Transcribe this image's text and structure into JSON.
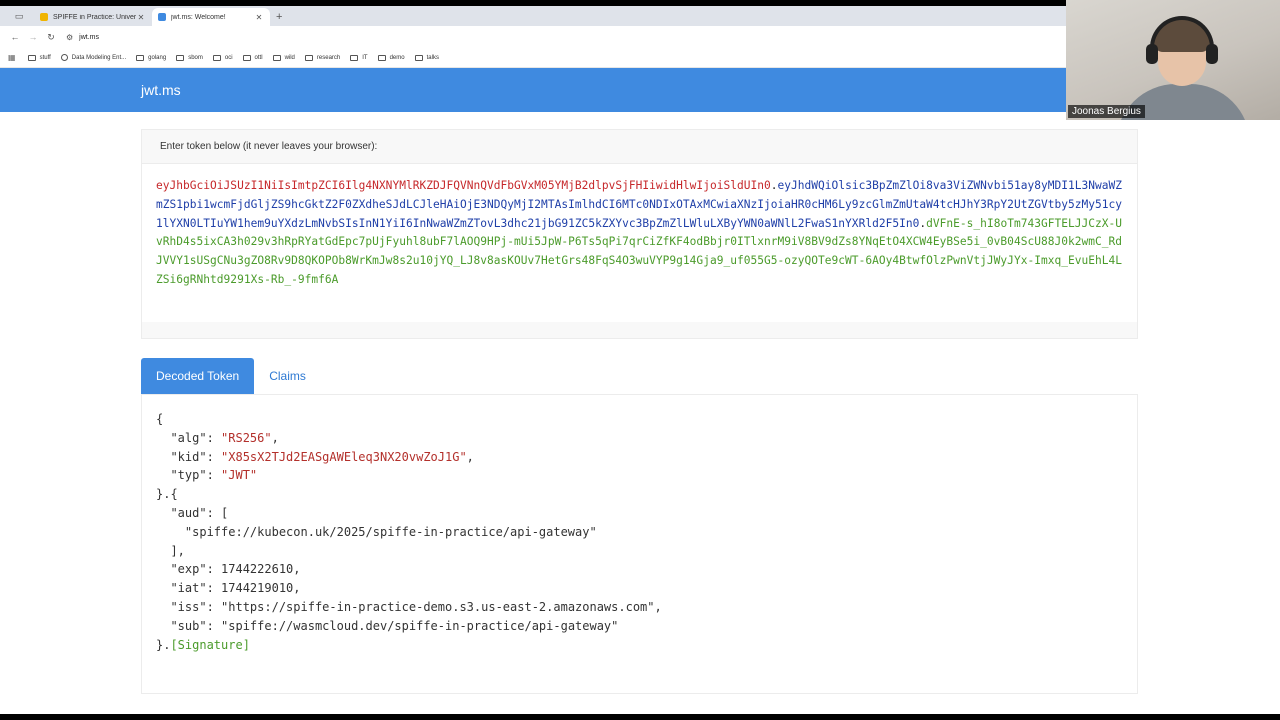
{
  "browser": {
    "tabs": [
      {
        "title": "SPIFFE in Practice: Universal",
        "active": false,
        "favicon_color": "#f0b400"
      },
      {
        "title": "jwt.ms: Welcome!",
        "active": true,
        "favicon_color": "#3f8ae0"
      }
    ],
    "url": "jwt.ms",
    "bookmarks": [
      {
        "label": "stuff",
        "type": "folder"
      },
      {
        "label": "Data Modeling Ent...",
        "type": "site"
      },
      {
        "label": "golang",
        "type": "folder"
      },
      {
        "label": "sbom",
        "type": "folder"
      },
      {
        "label": "oci",
        "type": "folder"
      },
      {
        "label": "ottl",
        "type": "folder"
      },
      {
        "label": "wild",
        "type": "folder"
      },
      {
        "label": "research",
        "type": "folder"
      },
      {
        "label": "IT",
        "type": "folder"
      },
      {
        "label": "demo",
        "type": "folder"
      },
      {
        "label": "talks",
        "type": "folder"
      }
    ]
  },
  "page": {
    "brand": "jwt.ms",
    "token_prompt": "Enter token below (it never leaves your browser):",
    "token": {
      "header": "eyJhbGciOiJSUzI1NiIsImtpZCI6Ilg4NXNYMlRKZDJFQVNnQVdFbGVxM05YMjB2dlpvSjFHIiwidHlwIjoiSldUIn0",
      "payload": "eyJhdWQiOlsic3BpZmZlOi8va3ViZWNvbi51ay8yMDI1L3NwaWZmZS1pbi1wcmFjdGljZS9hcGktZ2F0ZXdheSJdLCJleHAiOjE3NDQyMjI2MTAsImlhdCI6MTc0NDIxOTAxMCwiaXNzIjoiaHR0cHM6Ly9zcGlmZmUtaW4tcHJhY3RpY2UtZGVtby5zMy51cy1lYXN0LTIuYW1hem9uYXdzLmNvbSIsInN1YiI6InNwaWZmZTovL3dhc21jbG91ZC5kZXYvc3BpZmZlLWluLXByYWN0aWNlL2FwaS1nYXRld2F5In0",
      "signature": "dVFnE-s_hI8oTm743GFTELJJCzX-UvRhD4s5ixCA3h029v3hRpRYatGdEpc7pUjFyuhl8ubF7lAOQ9HPj-mUi5JpW-P6Ts5qPi7qrCiZfKF4odBbjr0ITlxnrM9iV8BV9dZs8YNqEtO4XCW4EyBSe5i_0vB04ScU88J0k2wmC_RdJVVY1sUSgCNu3gZO8Rv9D8QKOPOb8WrKmJw8s2u10jYQ_LJ8v8asKOUv7HetGrs48FqS4O3wuVYP9g14Gja9_uf055G5-ozyQOTe9cWT-6AOy4BtwfOlzPwnVtjJWyJYx-Imxq_EvuEhL4LZSi6gRNhtd9291Xs-Rb_-9fmf6A"
    },
    "tabs": {
      "decoded": "Decoded Token",
      "claims": "Claims"
    },
    "decoded": {
      "header": {
        "alg": "\"RS256\"",
        "kid": "\"X85sX2TJd2EASgAWEleq3NX20vwZoJ1G\"",
        "typ": "\"JWT\""
      },
      "payload": {
        "aud_item": "\"spiffe://kubecon.uk/2025/spiffe-in-practice/api-gateway\"",
        "exp": "1744222610,",
        "iat": "1744219010,",
        "iss": "\"https://spiffe-in-practice-demo.s3.us-east-2.amazonaws.com\",",
        "sub": "\"spiffe://wasmcloud.dev/spiffe-in-practice/api-gateway\""
      },
      "signature_label": "[Signature]"
    }
  },
  "webcam": {
    "name": "Joonas Bergius"
  },
  "colors": {
    "header_blue": "#3f8ae0",
    "token_header": "#c6282b",
    "token_payload": "#1f3fa8",
    "token_signature": "#4b9b2b"
  }
}
